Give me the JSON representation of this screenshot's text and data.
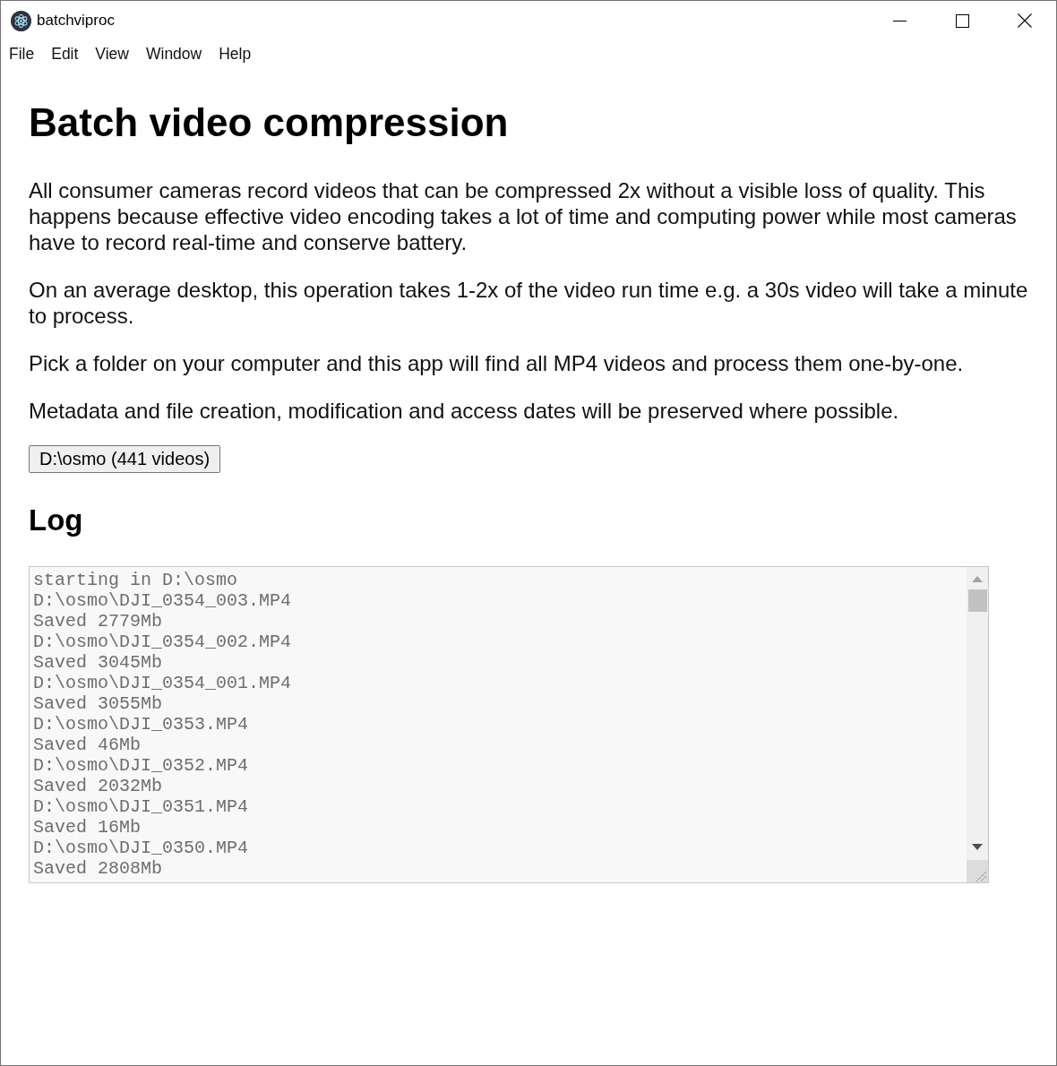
{
  "window": {
    "title": "batchviproc"
  },
  "menu": [
    "File",
    "Edit",
    "View",
    "Window",
    "Help"
  ],
  "heading": "Batch video compression",
  "paragraphs": [
    "All consumer cameras record videos that can be compressed 2x without a visible loss of quality. This happens because effective video encoding takes a lot of time and computing power while most cameras have to record real-time and conserve battery.",
    "On an average desktop, this operation takes 1-2x of the video run time e.g. a 30s video will take a minute to process.",
    "Pick a folder on your computer and this app will find all MP4 videos and process them one-by-one.",
    "Metadata and file creation, modification and access dates will be preserved where possible."
  ],
  "folder_button": "D:\\osmo (441 videos)",
  "log": {
    "title": "Log",
    "lines": [
      "starting in D:\\osmo",
      "D:\\osmo\\DJI_0354_003.MP4",
      "Saved 2779Mb",
      "D:\\osmo\\DJI_0354_002.MP4",
      "Saved 3045Mb",
      "D:\\osmo\\DJI_0354_001.MP4",
      "Saved 3055Mb",
      "D:\\osmo\\DJI_0353.MP4",
      "Saved 46Mb",
      "D:\\osmo\\DJI_0352.MP4",
      "Saved 2032Mb",
      "D:\\osmo\\DJI_0351.MP4",
      "Saved 16Mb",
      "D:\\osmo\\DJI_0350.MP4",
      "Saved 2808Mb"
    ]
  }
}
